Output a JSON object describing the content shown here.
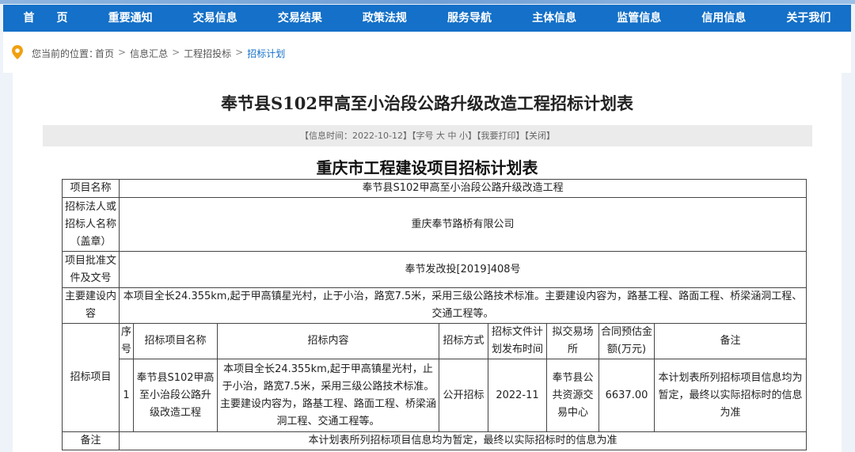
{
  "nav": {
    "items": [
      "首　　页",
      "重要通知",
      "交易信息",
      "交易结果",
      "政策法规",
      "服务导航",
      "主体信息",
      "监管信息",
      "信用信息",
      "关于我们"
    ]
  },
  "breadcrumb": {
    "label": "您当前的位置：",
    "items": [
      "首页",
      "信息汇总",
      "工程招投标",
      "招标计划"
    ]
  },
  "article": {
    "title": "奉节县S102甲高至小治段公路升级改造工程招标计划表",
    "info": {
      "time": "【信息时间：2022-10-12】",
      "font_size_prefix": "【字号",
      "font_large": "大",
      "font_medium": "中",
      "font_small": "小】",
      "print": "【我要打印】",
      "close": "【关闭】"
    }
  },
  "plan": {
    "title": "重庆市工程建设项目招标计划表",
    "project_name_label": "项目名称",
    "project_name": "奉节县S102甲高至小治段公路升级改造工程",
    "tenderer_label": "招标法人或招标人名称（盖章）",
    "tenderer": "重庆奉节路桥有限公司",
    "approval_label": "项目批准文件及文号",
    "approval": "奉节发改投[2019]408号",
    "scope_label": "主要建设内容",
    "scope": "本项目全长24.355km,起于甲高镇星光村，止于小治，路宽7.5米，采用三级公路技术标准。主要建设内容为，路基工程、路面工程、桥梁涵洞工程、交通工程等。",
    "items_label": "招标项目",
    "columns": [
      "序号",
      "招标项目名称",
      "招标内容",
      "招标方式",
      "招标文件计划发布时间",
      "拟交易场所",
      "合同预估金额(万元)",
      "备注"
    ],
    "rows": [
      {
        "no": "1",
        "name": "奉节县S102甲高至小治段公路升级改造工程",
        "content": "本项目全长24.355km,起于甲高镇星光村，止于小治，路宽7.5米，采用三级公路技术标准。主要建设内容为，路基工程、路面工程、桥梁涵洞工程、交通工程等。",
        "method": "公开招标",
        "time": "2022-11",
        "place": "奉节县公共资源交易中心",
        "amount": "6637.00",
        "remark": "本计划表所列招标项目信息均为暂定，最终以实际招标时的信息为准"
      }
    ],
    "remark_label": "备注",
    "remark": "本计划表所列招标项目信息均为暂定，最终以实际招标时的信息为准"
  }
}
